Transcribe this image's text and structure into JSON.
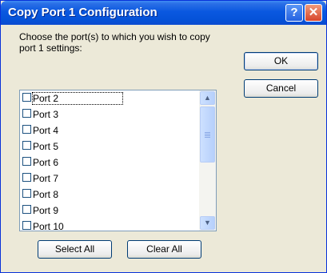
{
  "window": {
    "title": "Copy Port 1 Configuration"
  },
  "titlebar_buttons": {
    "help": "?",
    "close": "✕"
  },
  "prompt": "Choose the port(s) to which you wish to copy port 1 settings:",
  "ports": [
    {
      "label": "Port 2",
      "checked": false
    },
    {
      "label": "Port 3",
      "checked": false
    },
    {
      "label": "Port 4",
      "checked": false
    },
    {
      "label": "Port 5",
      "checked": false
    },
    {
      "label": "Port 6",
      "checked": false
    },
    {
      "label": "Port 7",
      "checked": false
    },
    {
      "label": "Port 8",
      "checked": false
    },
    {
      "label": "Port 9",
      "checked": false
    },
    {
      "label": "Port 10",
      "checked": false
    }
  ],
  "scrollbar": {
    "up_glyph": "▲",
    "down_glyph": "▼"
  },
  "buttons": {
    "ok": "OK",
    "cancel": "Cancel",
    "select_all": "Select All",
    "clear_all": "Clear All"
  }
}
